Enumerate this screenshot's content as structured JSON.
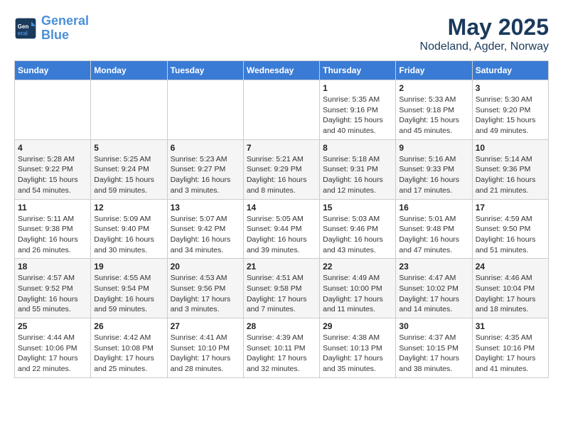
{
  "header": {
    "logo_line1": "General",
    "logo_line2": "Blue",
    "title": "May 2025",
    "subtitle": "Nodeland, Agder, Norway"
  },
  "weekdays": [
    "Sunday",
    "Monday",
    "Tuesday",
    "Wednesday",
    "Thursday",
    "Friday",
    "Saturday"
  ],
  "weeks": [
    [
      {
        "day": "",
        "info": ""
      },
      {
        "day": "",
        "info": ""
      },
      {
        "day": "",
        "info": ""
      },
      {
        "day": "",
        "info": ""
      },
      {
        "day": "1",
        "info": "Sunrise: 5:35 AM\nSunset: 9:16 PM\nDaylight: 15 hours\nand 40 minutes."
      },
      {
        "day": "2",
        "info": "Sunrise: 5:33 AM\nSunset: 9:18 PM\nDaylight: 15 hours\nand 45 minutes."
      },
      {
        "day": "3",
        "info": "Sunrise: 5:30 AM\nSunset: 9:20 PM\nDaylight: 15 hours\nand 49 minutes."
      }
    ],
    [
      {
        "day": "4",
        "info": "Sunrise: 5:28 AM\nSunset: 9:22 PM\nDaylight: 15 hours\nand 54 minutes."
      },
      {
        "day": "5",
        "info": "Sunrise: 5:25 AM\nSunset: 9:24 PM\nDaylight: 15 hours\nand 59 minutes."
      },
      {
        "day": "6",
        "info": "Sunrise: 5:23 AM\nSunset: 9:27 PM\nDaylight: 16 hours\nand 3 minutes."
      },
      {
        "day": "7",
        "info": "Sunrise: 5:21 AM\nSunset: 9:29 PM\nDaylight: 16 hours\nand 8 minutes."
      },
      {
        "day": "8",
        "info": "Sunrise: 5:18 AM\nSunset: 9:31 PM\nDaylight: 16 hours\nand 12 minutes."
      },
      {
        "day": "9",
        "info": "Sunrise: 5:16 AM\nSunset: 9:33 PM\nDaylight: 16 hours\nand 17 minutes."
      },
      {
        "day": "10",
        "info": "Sunrise: 5:14 AM\nSunset: 9:36 PM\nDaylight: 16 hours\nand 21 minutes."
      }
    ],
    [
      {
        "day": "11",
        "info": "Sunrise: 5:11 AM\nSunset: 9:38 PM\nDaylight: 16 hours\nand 26 minutes."
      },
      {
        "day": "12",
        "info": "Sunrise: 5:09 AM\nSunset: 9:40 PM\nDaylight: 16 hours\nand 30 minutes."
      },
      {
        "day": "13",
        "info": "Sunrise: 5:07 AM\nSunset: 9:42 PM\nDaylight: 16 hours\nand 34 minutes."
      },
      {
        "day": "14",
        "info": "Sunrise: 5:05 AM\nSunset: 9:44 PM\nDaylight: 16 hours\nand 39 minutes."
      },
      {
        "day": "15",
        "info": "Sunrise: 5:03 AM\nSunset: 9:46 PM\nDaylight: 16 hours\nand 43 minutes."
      },
      {
        "day": "16",
        "info": "Sunrise: 5:01 AM\nSunset: 9:48 PM\nDaylight: 16 hours\nand 47 minutes."
      },
      {
        "day": "17",
        "info": "Sunrise: 4:59 AM\nSunset: 9:50 PM\nDaylight: 16 hours\nand 51 minutes."
      }
    ],
    [
      {
        "day": "18",
        "info": "Sunrise: 4:57 AM\nSunset: 9:52 PM\nDaylight: 16 hours\nand 55 minutes."
      },
      {
        "day": "19",
        "info": "Sunrise: 4:55 AM\nSunset: 9:54 PM\nDaylight: 16 hours\nand 59 minutes."
      },
      {
        "day": "20",
        "info": "Sunrise: 4:53 AM\nSunset: 9:56 PM\nDaylight: 17 hours\nand 3 minutes."
      },
      {
        "day": "21",
        "info": "Sunrise: 4:51 AM\nSunset: 9:58 PM\nDaylight: 17 hours\nand 7 minutes."
      },
      {
        "day": "22",
        "info": "Sunrise: 4:49 AM\nSunset: 10:00 PM\nDaylight: 17 hours\nand 11 minutes."
      },
      {
        "day": "23",
        "info": "Sunrise: 4:47 AM\nSunset: 10:02 PM\nDaylight: 17 hours\nand 14 minutes."
      },
      {
        "day": "24",
        "info": "Sunrise: 4:46 AM\nSunset: 10:04 PM\nDaylight: 17 hours\nand 18 minutes."
      }
    ],
    [
      {
        "day": "25",
        "info": "Sunrise: 4:44 AM\nSunset: 10:06 PM\nDaylight: 17 hours\nand 22 minutes."
      },
      {
        "day": "26",
        "info": "Sunrise: 4:42 AM\nSunset: 10:08 PM\nDaylight: 17 hours\nand 25 minutes."
      },
      {
        "day": "27",
        "info": "Sunrise: 4:41 AM\nSunset: 10:10 PM\nDaylight: 17 hours\nand 28 minutes."
      },
      {
        "day": "28",
        "info": "Sunrise: 4:39 AM\nSunset: 10:11 PM\nDaylight: 17 hours\nand 32 minutes."
      },
      {
        "day": "29",
        "info": "Sunrise: 4:38 AM\nSunset: 10:13 PM\nDaylight: 17 hours\nand 35 minutes."
      },
      {
        "day": "30",
        "info": "Sunrise: 4:37 AM\nSunset: 10:15 PM\nDaylight: 17 hours\nand 38 minutes."
      },
      {
        "day": "31",
        "info": "Sunrise: 4:35 AM\nSunset: 10:16 PM\nDaylight: 17 hours\nand 41 minutes."
      }
    ]
  ]
}
